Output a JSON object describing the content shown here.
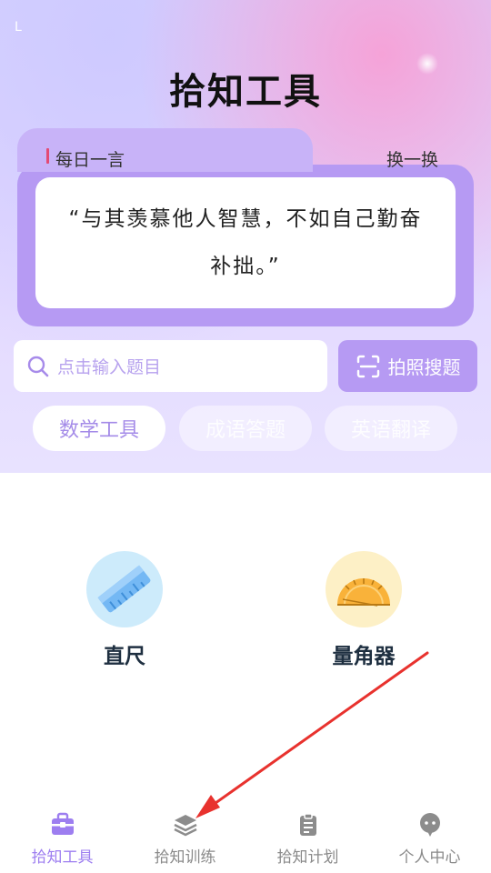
{
  "status": {
    "left_glyph": "L"
  },
  "app": {
    "title": "拾知工具"
  },
  "daily_quote": {
    "label": "每日一言",
    "refresh_label": "换一换",
    "text": "“与其羡慕他人智慧，不如自己勤奋补拙。”"
  },
  "search": {
    "placeholder": "点击输入题目",
    "photo_button_label": "拍照搜题"
  },
  "categories": [
    {
      "label": "数学工具",
      "active": true
    },
    {
      "label": "成语答题",
      "active": false
    },
    {
      "label": "英语翻译",
      "active": false
    }
  ],
  "tools": [
    {
      "label": "直尺",
      "icon": "ruler-icon"
    },
    {
      "label": "量角器",
      "icon": "protractor-icon"
    }
  ],
  "tabbar": [
    {
      "label": "拾知工具",
      "icon": "toolbox-icon",
      "active": true
    },
    {
      "label": "拾知训练",
      "icon": "layers-icon",
      "active": false
    },
    {
      "label": "拾知计划",
      "icon": "clipboard-icon",
      "active": false
    },
    {
      "label": "个人中心",
      "icon": "chat-bubble-icon",
      "active": false
    }
  ],
  "colors": {
    "accent": "#b69af3",
    "active_tab": "#9d7ef0",
    "annotation_arrow": "#e8322e"
  }
}
